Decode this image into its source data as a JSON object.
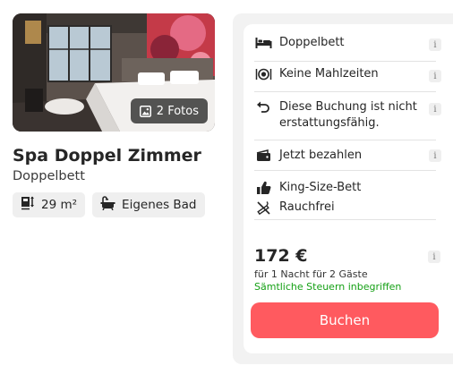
{
  "room": {
    "photo_badge": "2 Fotos",
    "title": "Spa Doppel Zimmer",
    "subtitle": "Doppelbett",
    "chips": [
      {
        "icon": "room-size-icon",
        "label": "29 m²"
      },
      {
        "icon": "bathtub-icon",
        "label": "Eigenes Bad"
      }
    ]
  },
  "offer": {
    "features": [
      {
        "icon": "bed-icon",
        "text": "Doppelbett",
        "info": "i"
      },
      {
        "icon": "meal-icon",
        "text": "Keine Mahlzeiten",
        "info": "i"
      },
      {
        "icon": "undo-icon",
        "text": "Diese Buchung ist nicht erstattungsfähig.",
        "info": "i"
      },
      {
        "icon": "wallet-icon",
        "text": "Jetzt bezahlen",
        "info": "i"
      }
    ],
    "amenities": [
      {
        "icon": "thumbs-up-icon",
        "text": "King-Size-Bett"
      },
      {
        "icon": "no-smoking-icon",
        "text": "Rauchfrei"
      }
    ],
    "price": "172 €",
    "price_info": "i",
    "price_detail": "für 1 Nacht für 2 Gäste",
    "tax_note": "Sämtliche Steuern inbegriffen",
    "book_label": "Buchen"
  },
  "colors": {
    "accent": "#ff5a5f",
    "tax_green": "#14a014"
  }
}
